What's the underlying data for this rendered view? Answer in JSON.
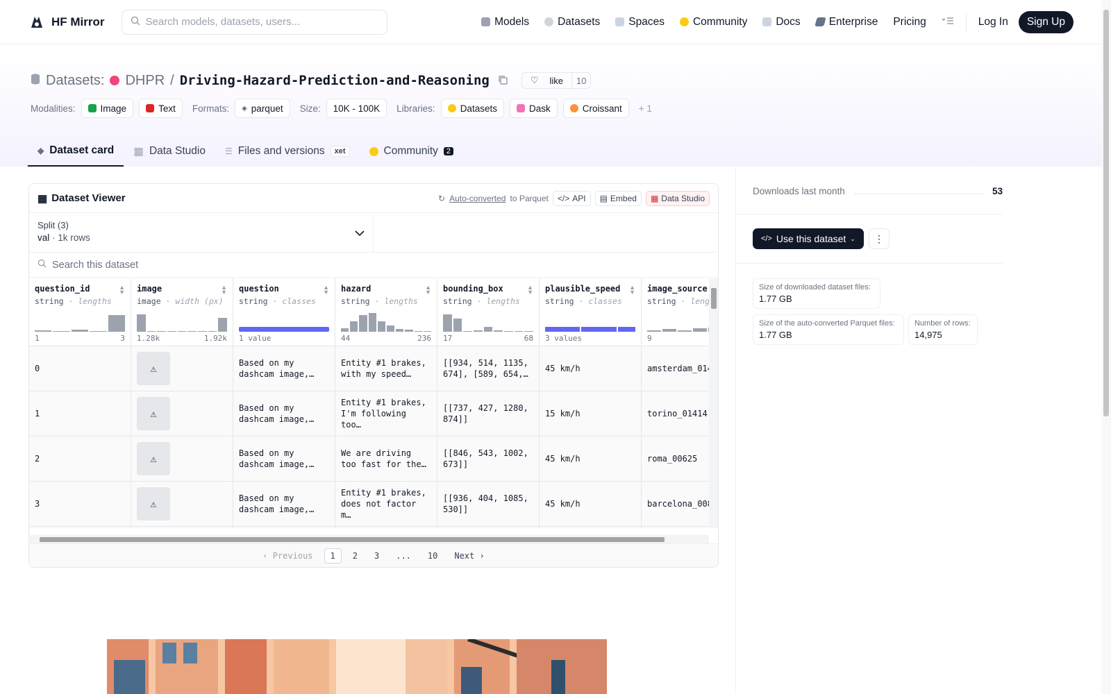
{
  "nav": {
    "brand": "HF Mirror",
    "search_placeholder": "Search models, datasets, users...",
    "links": [
      "Models",
      "Datasets",
      "Spaces",
      "Community",
      "Docs",
      "Enterprise",
      "Pricing"
    ],
    "login": "Log In",
    "signup": "Sign Up"
  },
  "header": {
    "section_label": "Datasets:",
    "org": "DHPR",
    "slash": "/",
    "repo": "Driving-Hazard-Prediction-and-Reasoning",
    "like_label": "like",
    "like_count": "10",
    "modalities_label": "Modalities:",
    "modalities": [
      "Image",
      "Text"
    ],
    "formats_label": "Formats:",
    "format": "parquet",
    "size_label": "Size:",
    "size": "10K - 100K",
    "libraries_label": "Libraries:",
    "libraries": [
      "Datasets",
      "Dask",
      "Croissant"
    ],
    "more_libraries": "+ 1"
  },
  "tabs": {
    "dataset_card": "Dataset card",
    "data_studio": "Data Studio",
    "files": "Files and versions",
    "xet": "xet",
    "community": "Community",
    "community_count": "2"
  },
  "viewer": {
    "title": "Dataset Viewer",
    "autoconverted": "Auto-converted",
    "to_parquet": "to Parquet",
    "api": "API",
    "embed": "Embed",
    "data_studio": "Data Studio",
    "split_label": "Split (3)",
    "split_value": "val",
    "split_rows": "1k rows",
    "search_placeholder": "Search this dataset",
    "columns": [
      {
        "name": "question_id",
        "type": "string",
        "sub": "lengths",
        "min": "1",
        "max": "3"
      },
      {
        "name": "image",
        "type": "image",
        "sub": "width (px)",
        "min": "1.28k",
        "max": "1.92k"
      },
      {
        "name": "question",
        "type": "string",
        "sub": "classes",
        "min": "1 value",
        "max": ""
      },
      {
        "name": "hazard",
        "type": "string",
        "sub": "lengths",
        "min": "44",
        "max": "236"
      },
      {
        "name": "bounding_box",
        "type": "string",
        "sub": "lengths",
        "min": "17",
        "max": "68"
      },
      {
        "name": "plausible_speed",
        "type": "string",
        "sub": "classes",
        "min": "3 values",
        "max": ""
      },
      {
        "name": "image_source",
        "type": "string",
        "sub": "leng",
        "min": "9",
        "max": ""
      }
    ],
    "rows": [
      [
        "0",
        "",
        "Based on my dashcam image,…",
        "Entity #1 brakes, with my speed…",
        "[[934, 514, 1135, 674], [589, 654,…",
        "45 km/h",
        "amsterdam_014"
      ],
      [
        "1",
        "",
        "Based on my dashcam image,…",
        "Entity #1 brakes, I'm following too…",
        "[[737, 427, 1280, 874]]",
        "15 km/h",
        "torino_01414"
      ],
      [
        "2",
        "",
        "Based on my dashcam image,…",
        "We are driving too fast for the…",
        "[[846, 543, 1002, 673]]",
        "45 km/h",
        "roma_00625"
      ],
      [
        "3",
        "",
        "Based on my dashcam image,…",
        "Entity #1 brakes, does not factor m…",
        "[[936, 404, 1085, 530]]",
        "45 km/h",
        "barcelona_008"
      ]
    ],
    "pager": {
      "prev": "Previous",
      "pages": [
        "1",
        "2",
        "3",
        "...",
        "10"
      ],
      "next": "Next"
    }
  },
  "sidebar": {
    "downloads_label": "Downloads last month",
    "downloads": "53",
    "use_button": "Use this dataset",
    "stats": [
      {
        "k": "Size of downloaded dataset files:",
        "v": "1.77 GB"
      },
      {
        "k": "Size of the auto-converted Parquet files:",
        "v": "1.77 GB"
      },
      {
        "k": "Number of rows:",
        "v": "14,975"
      }
    ]
  }
}
